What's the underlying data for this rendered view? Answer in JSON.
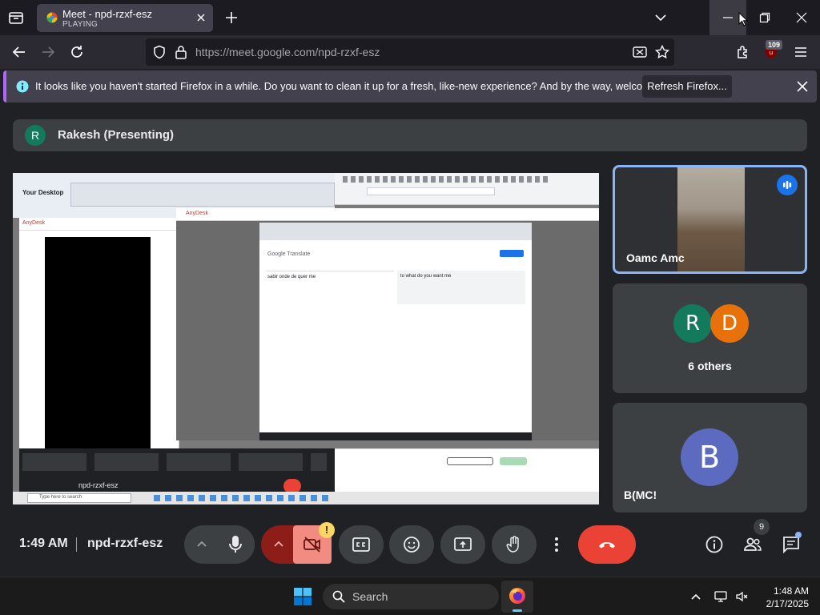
{
  "browser": {
    "tab": {
      "title": "Meet - npd-rzxf-esz",
      "status": "PLAYING"
    },
    "url": {
      "host": "https://meet.google.com",
      "path": "/npd-rzxf-esz"
    },
    "extension_badge": "109"
  },
  "notification": {
    "message": "It looks like you haven't started Firefox in a while. Do you want to clean it up for a fresh, like-new experience? And by the way, welcome back!",
    "button": "Refresh Firefox..."
  },
  "meet": {
    "presenter": {
      "initial": "R",
      "label": "Rakesh (Presenting)"
    },
    "shared_screen": {
      "desktop_label": "Your Desktop",
      "anydesk_label": "AnyDesk",
      "translate_title": "Google Translate",
      "source_text": "sabir onde de quer me",
      "target_text": "to what do you want me",
      "taskbar_search": "Type here to search",
      "meet_code": "npd-rzxf-esz"
    },
    "participants": [
      {
        "name": "Oamc Amc",
        "speaking": true
      },
      {
        "initials": [
          "R",
          "D"
        ],
        "colors": [
          "#137a5b",
          "#e8710a"
        ],
        "label": "6 others"
      },
      {
        "initial": "B",
        "color": "#5c6bc0",
        "name": "B(MC!"
      }
    ],
    "controls": {
      "time": "1:49 AM",
      "meeting_code": "npd-rzxf-esz",
      "camera_warning": "!",
      "people_count": "9"
    },
    "colors": {
      "leave": "#ea4335",
      "camera_off": "#f28b82",
      "mic_chevron_bg": "#8c1d18"
    }
  },
  "taskbar": {
    "search_placeholder": "Search",
    "time": "1:48 AM",
    "date": "2/17/2025"
  }
}
